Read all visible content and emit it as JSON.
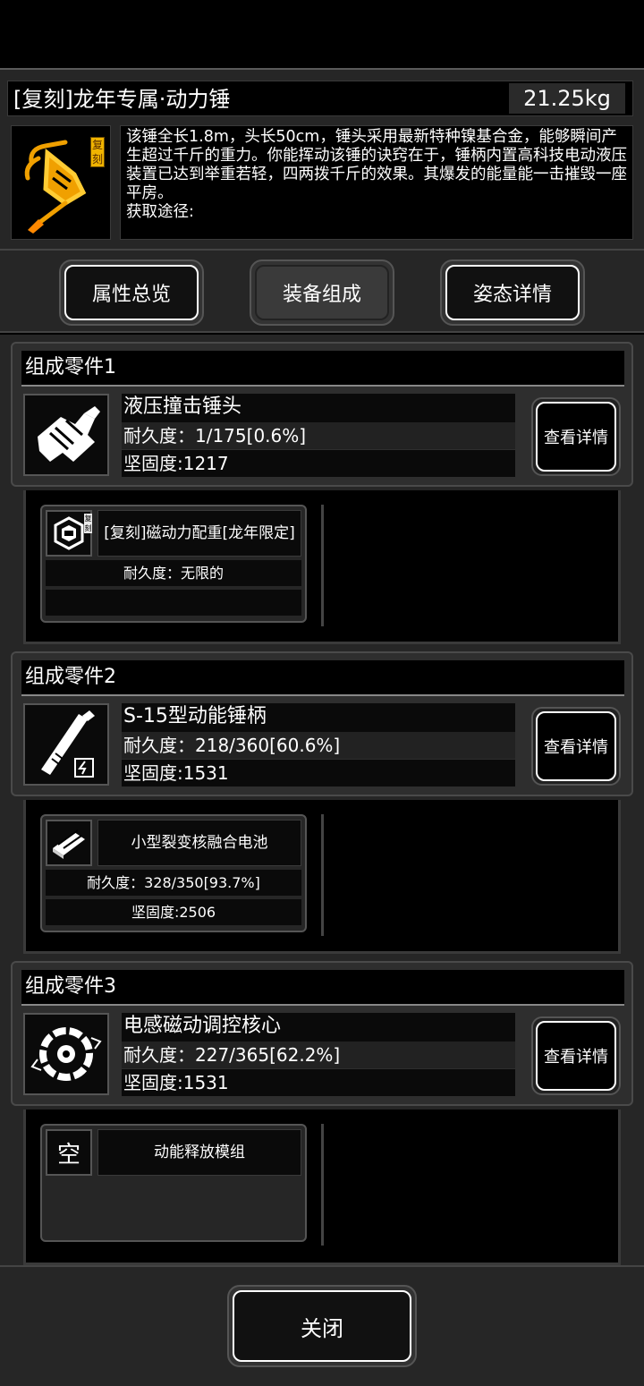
{
  "item": {
    "name": "[复刻]龙年专属·动力锤",
    "weight": "21.25kg",
    "badge": "复刻",
    "description": "该锤全长1.8m，头长50cm，锤头采用最新特种镍基合金，能够瞬间产生超过千斤的重力。你能挥动该锤的诀窍在于，锤柄内置高科技电动液压装置已达到举重若轻，四两拨千斤的效果。其爆发的能量能一击摧毁一座平房。",
    "source": "获取途径:",
    "icon": "power-hammer-icon"
  },
  "tabs": [
    {
      "label": "属性总览",
      "selected": false
    },
    {
      "label": "装备组成",
      "selected": true
    },
    {
      "label": "姿态详情",
      "selected": false
    }
  ],
  "parts": [
    {
      "section_title": "组成零件1",
      "name": "液压撞击锤头",
      "durability": "耐久度：1/175[0.6%]",
      "hardness": "坚固度:1217",
      "detail_label": "查看详情",
      "icon": "hammer-head-icon",
      "sub": {
        "name": "[复刻]磁动力配重[龙年限定]",
        "badge": "复刻",
        "line1": "耐久度：无限的",
        "line2": "",
        "icon": "magnetic-weight-icon"
      }
    },
    {
      "section_title": "组成零件2",
      "name": "S-15型动能锤柄",
      "durability": "耐久度：218/360[60.6%]",
      "hardness": "坚固度:1531",
      "detail_label": "查看详情",
      "icon": "hammer-handle-icon",
      "sub": {
        "name": "小型裂变核融合电池",
        "line1": "耐久度：328/350[93.7%]",
        "line2": "坚固度:2506",
        "icon": "battery-icon"
      }
    },
    {
      "section_title": "组成零件3",
      "name": "电感磁动调控核心",
      "durability": "耐久度：227/365[62.2%]",
      "hardness": "坚固度:1531",
      "detail_label": "查看详情",
      "icon": "gear-core-icon",
      "sub": {
        "empty_label": "空",
        "name": "动能释放模组"
      }
    }
  ],
  "close_label": "关闭",
  "colors": {
    "badge": "#f0b400",
    "accent": "#ffffff",
    "panel": "#262626"
  }
}
